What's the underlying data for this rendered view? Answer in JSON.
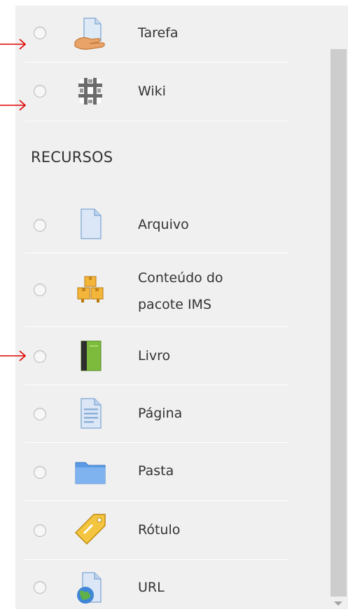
{
  "activities_partial": [
    {
      "label": "Tarefa",
      "icon": "assignment-icon"
    },
    {
      "label": "Wiki",
      "icon": "wiki-icon"
    }
  ],
  "resources_section": {
    "title": "RECURSOS",
    "items": [
      {
        "label": "Arquivo",
        "icon": "file-icon"
      },
      {
        "label_line1": "Conteúdo do",
        "label_line2": "pacote IMS",
        "icon": "ims-package-icon"
      },
      {
        "label": "Livro",
        "icon": "book-icon"
      },
      {
        "label": "Página",
        "icon": "page-icon"
      },
      {
        "label": "Pasta",
        "icon": "folder-icon"
      },
      {
        "label": "Rótulo",
        "icon": "label-tag-icon"
      },
      {
        "label": "URL",
        "icon": "url-icon"
      }
    ]
  },
  "annotation_color": "#e00000"
}
